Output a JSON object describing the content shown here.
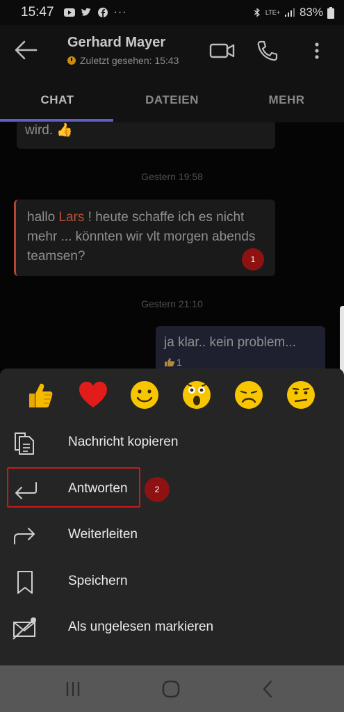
{
  "status_bar": {
    "time": "15:47",
    "battery": "83%",
    "network": "LTE+",
    "icons": [
      "youtube-icon",
      "twitter-icon",
      "facebook-icon",
      "more-icon",
      "bluetooth-icon",
      "signal-icon",
      "battery-icon"
    ]
  },
  "header": {
    "contact_name": "Gerhard Mayer",
    "last_seen": "Zuletzt gesehen: 15:43",
    "icons": [
      "back-arrow-icon",
      "video-call-icon",
      "phone-call-icon",
      "more-vertical-icon"
    ]
  },
  "tabs": [
    {
      "label": "CHAT",
      "active": true
    },
    {
      "label": "DATEIEN",
      "active": false
    },
    {
      "label": "MEHR",
      "active": false
    }
  ],
  "chat": {
    "messages": [
      {
        "text": "wird. 👍"
      },
      {
        "date": "Gestern 19:58"
      },
      {
        "text_before": "hallo ",
        "mention": "Lars",
        "text_after": " ! heute schaffe ich es nicht mehr ... könnten wir vlt morgen abends teamsen?",
        "badge": "1"
      },
      {
        "date": "Gestern 21:10"
      },
      {
        "text": "ja klar.. kein problem...",
        "reaction_count": "1"
      }
    ]
  },
  "reactions": [
    "like-emoji",
    "heart-emoji",
    "smile-emoji",
    "surprised-emoji",
    "sad-emoji",
    "confused-emoji"
  ],
  "menu": [
    {
      "label": "Nachricht kopieren",
      "icon": "copy-icon"
    },
    {
      "label": "Antworten",
      "icon": "reply-icon",
      "badge": "2",
      "highlighted": true
    },
    {
      "label": "Weiterleiten",
      "icon": "forward-icon"
    },
    {
      "label": "Speichern",
      "icon": "bookmark-icon"
    },
    {
      "label": "Als ungelesen markieren",
      "icon": "mark-unread-icon"
    }
  ],
  "colors": {
    "accent": "#5b5fc7",
    "mention": "#b9503a",
    "badge": "#8f1212",
    "highlight_border": "#c11d1d"
  }
}
